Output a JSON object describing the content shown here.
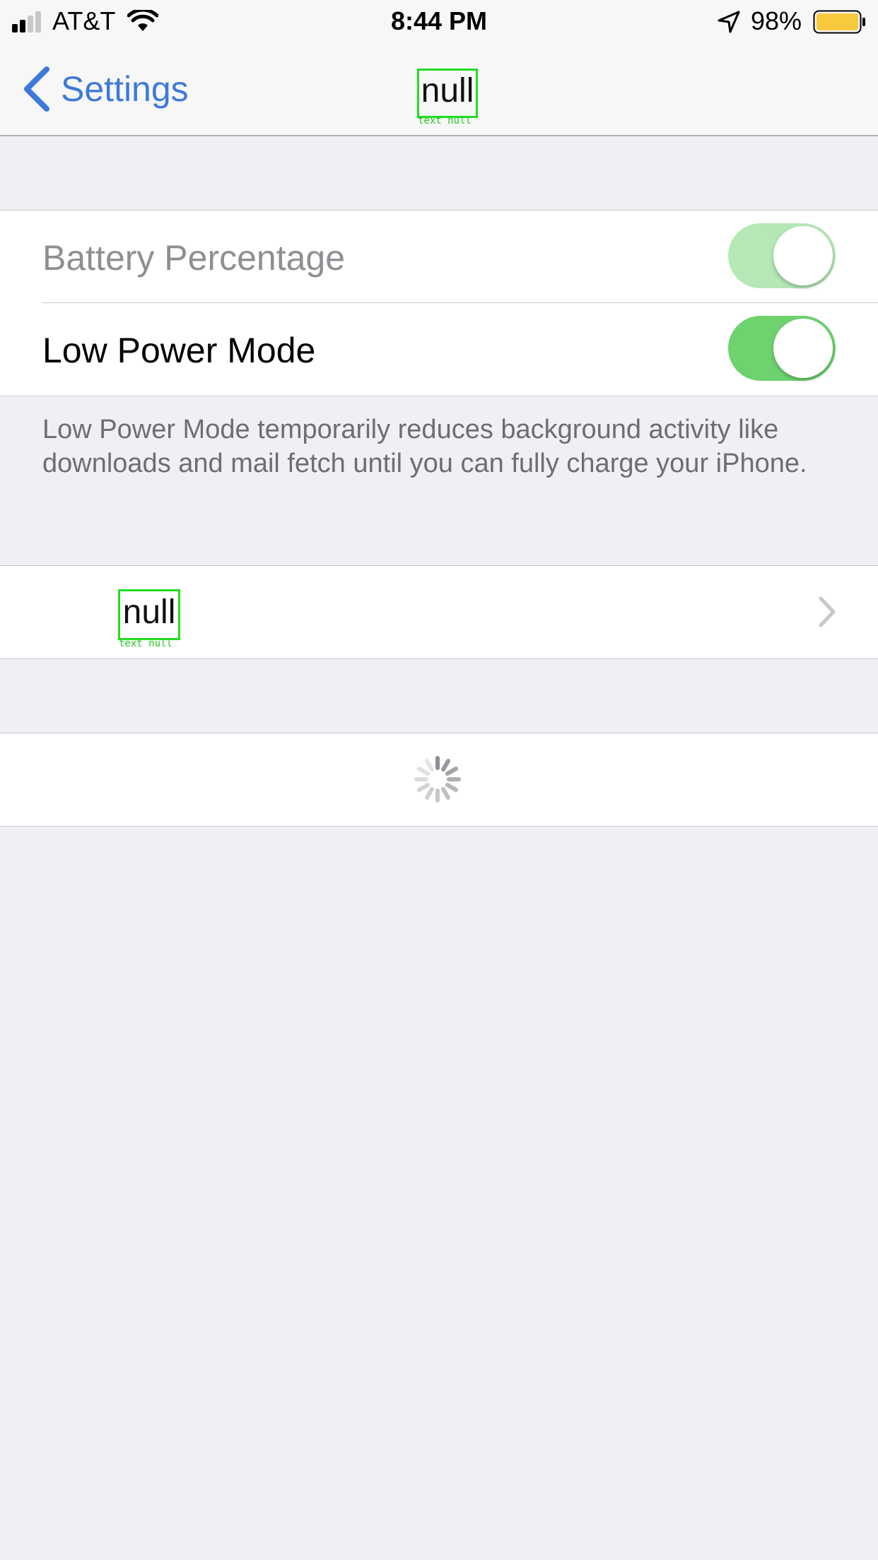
{
  "status_bar": {
    "carrier": "AT&T",
    "time": "8:44 PM",
    "battery_percent": "98%",
    "battery_color": "#f8c93c"
  },
  "nav": {
    "back_label": "Settings",
    "title": "null",
    "title_annotation": "text null"
  },
  "settings": {
    "battery_percentage": {
      "label": "Battery Percentage",
      "on": true,
      "enabled": false
    },
    "low_power_mode": {
      "label": "Low Power Mode",
      "on": true,
      "enabled": true
    },
    "footer": "Low Power Mode temporarily reduces background activity like downloads and mail fetch until you can fully charge your iPhone."
  },
  "battery_usage_cell": {
    "label": "null",
    "annotation": "text null"
  },
  "colors": {
    "accent": "#3d7ad9",
    "toggle_on": "#6ed26f",
    "toggle_disabled": "#b5e8b6",
    "background": "#efeff4"
  }
}
